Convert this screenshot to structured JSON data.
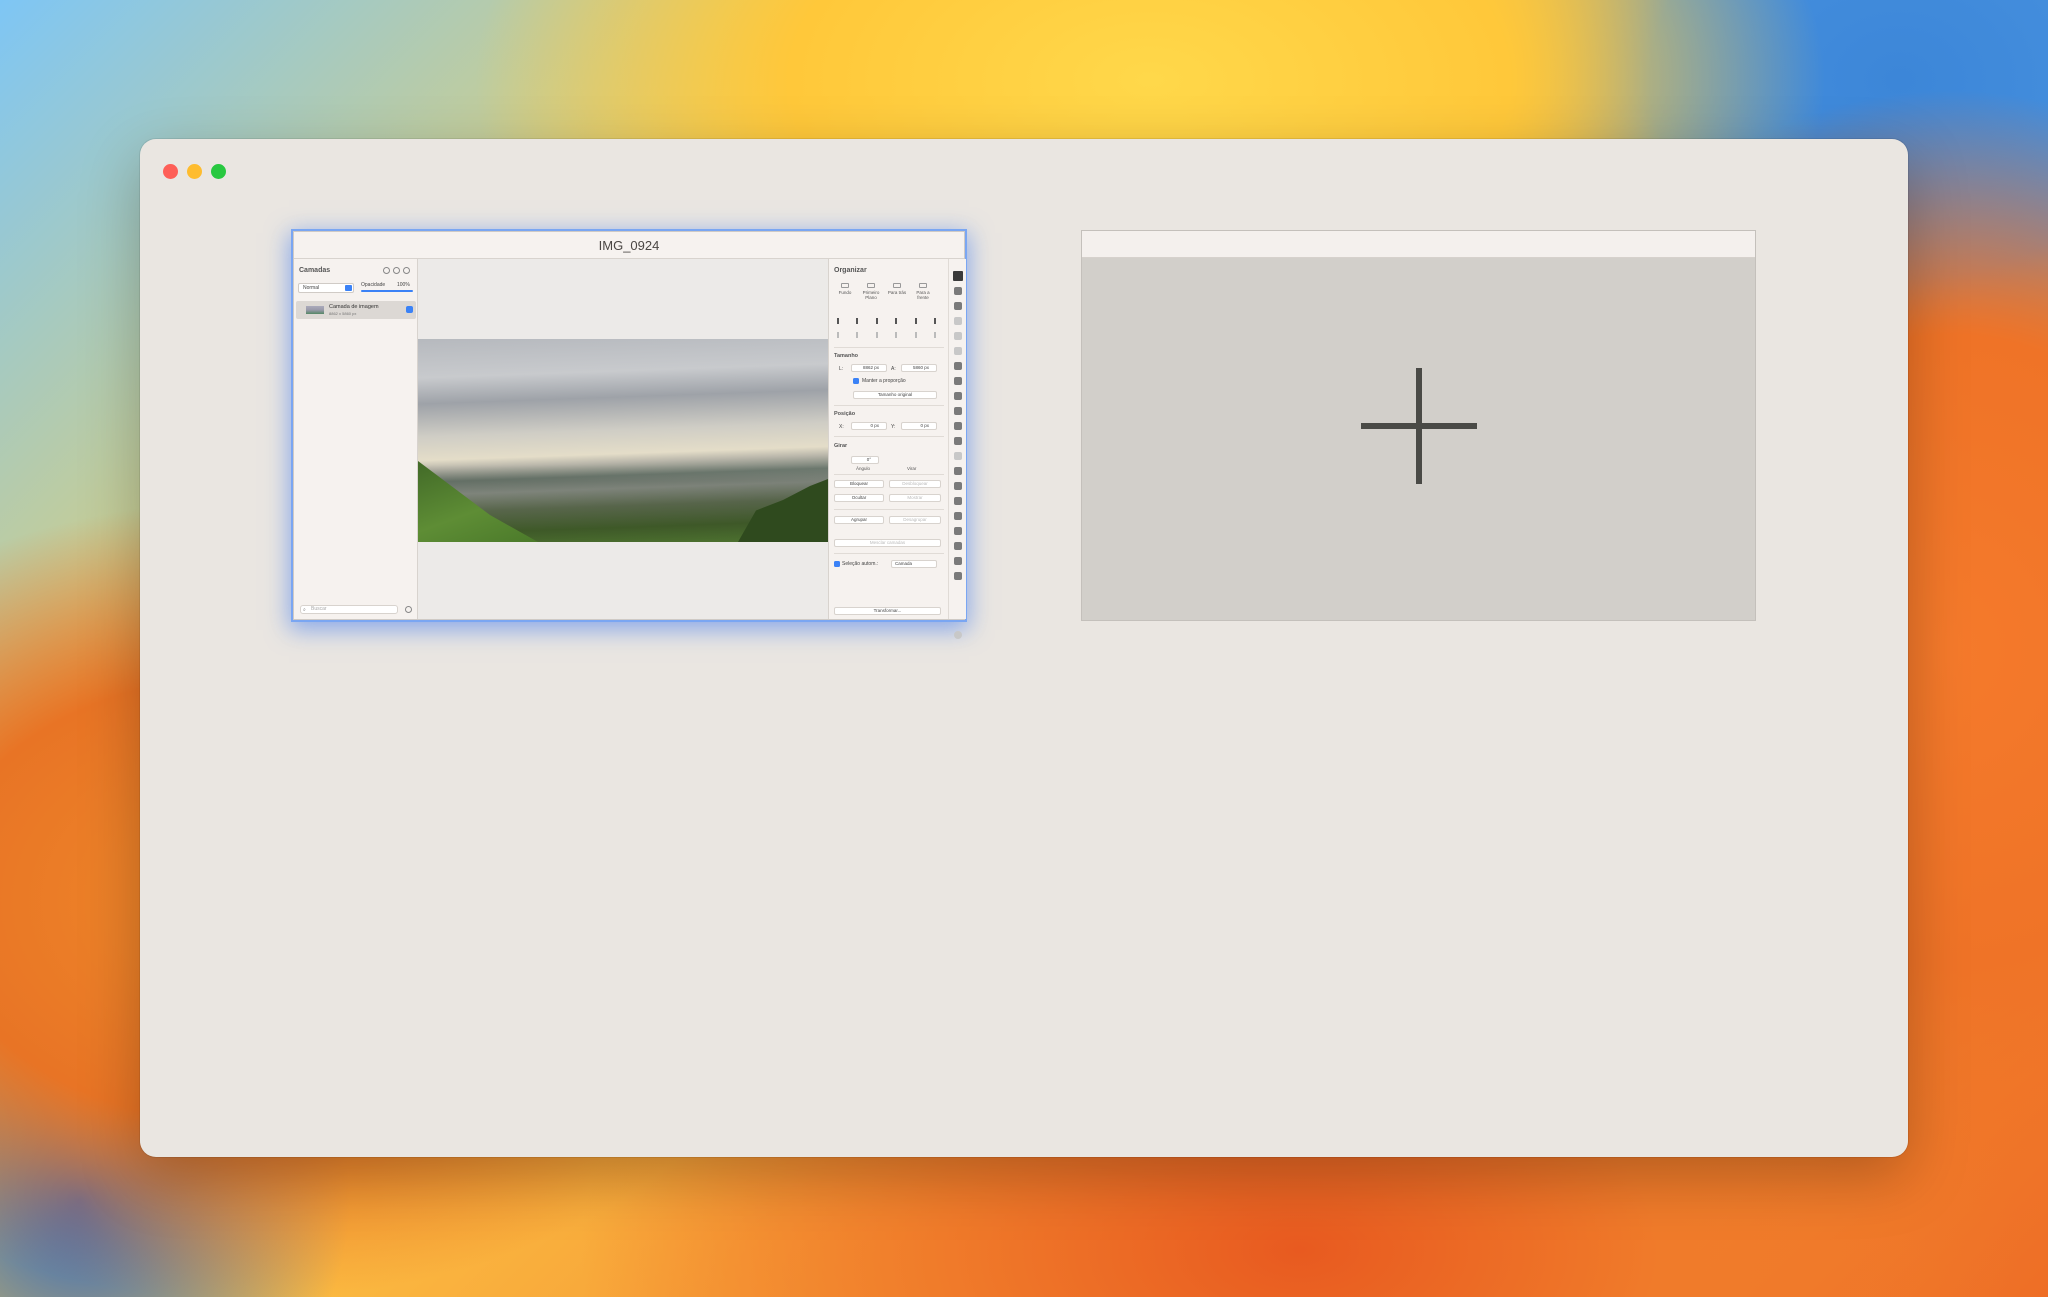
{
  "window": {
    "controls": [
      "close",
      "minimize",
      "maximize"
    ]
  },
  "document": {
    "title": "IMG_0924",
    "layers_panel": {
      "title": "Camadas",
      "blend_mode": "Normal",
      "opacity_label": "Opacidade",
      "opacity_value": "100%",
      "layers": [
        {
          "name": "Camada de imagem",
          "size": "8862 x 5860 px",
          "visible": true
        }
      ],
      "search_placeholder": "Buscar"
    },
    "inspector": {
      "title": "Organizar",
      "arrange_buttons": [
        "Fundo",
        "Primeiro Plano",
        "Para trás",
        "Para a frente"
      ],
      "size_section": "Tamanho",
      "width_label": "L:",
      "width_value": "8862 px",
      "height_label": "A:",
      "height_value": "5860 px",
      "keep_ratio_label": "Manter a proporção",
      "original_size_button": "Tamanho original",
      "position_section": "Posição",
      "x_label": "X:",
      "x_value": "0 px",
      "y_label": "Y:",
      "y_value": "0 px",
      "rotate_section": "Girar",
      "angle_value": "0°",
      "angle_label": "Ângulo",
      "flip_label": "Virar",
      "lock_button": "Bloquear",
      "unlock_button": "Desbloquear",
      "hide_button": "Ocultar",
      "show_button": "Mostrar",
      "group_button": "Agrupar",
      "ungroup_button": "Desagrupar",
      "merge_button": "Mesclar camadas",
      "auto_select_label": "Seleção autom.:",
      "auto_select_value": "Camada",
      "transform_button": "Transformar..."
    }
  },
  "new_document": {
    "icon": "plus-icon"
  },
  "colors": {
    "accent": "#3b82f6",
    "window_bg": "#eae6e1",
    "close": "#fe5f57",
    "minimize": "#febc2e",
    "maximize": "#28c840"
  }
}
